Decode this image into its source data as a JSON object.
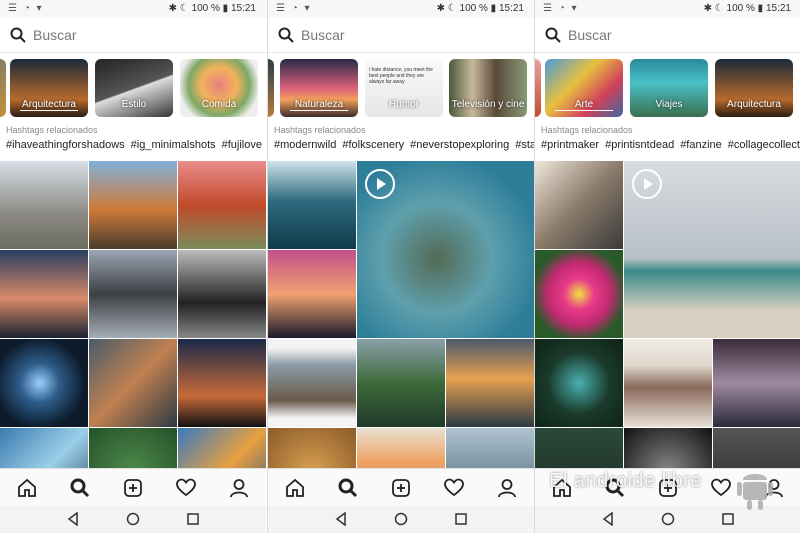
{
  "status_bar": {
    "battery": "100 %",
    "time": "15:21"
  },
  "search": {
    "placeholder": "Buscar"
  },
  "panels": [
    {
      "categories": [
        {
          "label": ""
        },
        {
          "label": "Arquitectura"
        },
        {
          "label": "Estilo"
        },
        {
          "label": "Comida"
        }
      ],
      "hashtags_title": "Hashtags relacionados",
      "hashtags": [
        "#ihaveathingforshadows",
        "#ig_minimalshots",
        "#fujilove",
        "#"
      ]
    },
    {
      "categories": [
        {
          "label": "Naturaleza"
        },
        {
          "label": "Humor"
        },
        {
          "label": "Televisión y cine"
        }
      ],
      "humor_caption": "i hate distance, you meet the best people and they are always far away",
      "hashtags_title": "Hashtags relacionados",
      "hashtags": [
        "#modernwild",
        "#folkscenery",
        "#neverstopexploring",
        "#stayp"
      ]
    },
    {
      "categories": [
        {
          "label": "Arte"
        },
        {
          "label": "Viajes"
        },
        {
          "label": "Arquitectura"
        }
      ],
      "hashtags_title": "Hashtags relacionados",
      "hashtags": [
        "#printmaker",
        "#printisntdead",
        "#fanzine",
        "#collagecollective"
      ]
    }
  ],
  "bottom_nav": [
    "home-icon",
    "search-icon",
    "add-icon",
    "heart-icon",
    "profile-icon"
  ],
  "watermark": "El androide libre"
}
